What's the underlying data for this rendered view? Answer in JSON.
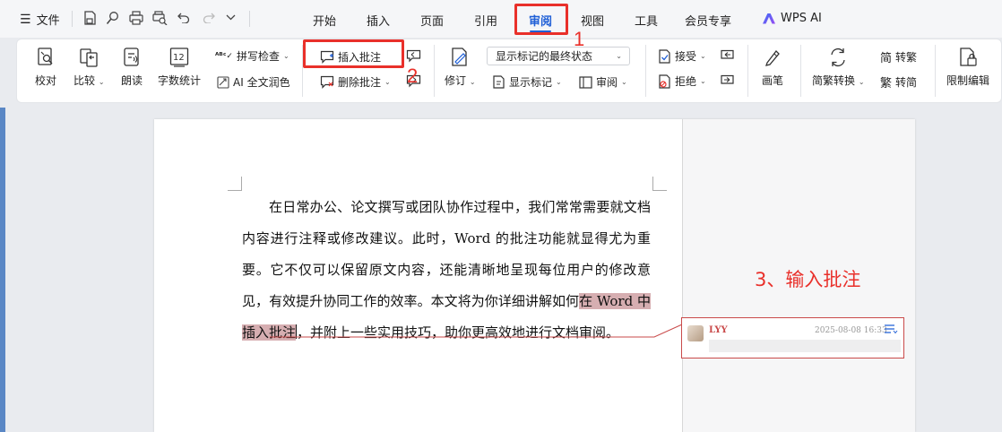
{
  "menu": {
    "file_label": "文件",
    "tabs": [
      {
        "label": "开始"
      },
      {
        "label": "插入"
      },
      {
        "label": "页面"
      },
      {
        "label": "引用"
      },
      {
        "label": "审阅",
        "active": true
      },
      {
        "label": "视图"
      },
      {
        "label": "工具"
      },
      {
        "label": "会员专享"
      }
    ],
    "wps_ai_label": "WPS AI",
    "quick_access_icons": [
      "save-icon",
      "find-icon",
      "print-icon",
      "print-preview-icon",
      "undo-icon",
      "redo-icon",
      "chevron-down-icon"
    ]
  },
  "ribbon": {
    "proofread": "校对",
    "compare": "比较",
    "read_aloud": "朗读",
    "word_count": "字数统计",
    "spell_check": "拼写检查",
    "ai_polish": "AI 全文润色",
    "insert_comment": "插入批注",
    "delete_comment": "删除批注",
    "track_changes": "修订",
    "markup_mode": "显示标记的最终状态",
    "show_markup": "显示标记",
    "review": "审阅",
    "accept": "接受",
    "reject": "拒绝",
    "pen": "画笔",
    "sc_convert": "简繁转换",
    "to_traditional": "转繁",
    "to_simplified": "转简",
    "restrict_editing": "限制编辑"
  },
  "annotations": {
    "step1": "1",
    "step2": "2",
    "step3": "3、输入批注",
    "color": "#e9302a"
  },
  "document": {
    "text_before": "在日常办公、论文撰写或团队协作过程中，我们常常需要就文档内容进行注释或修改建议。此时，Word 的批注功能就显得尤为重要。它不仅可以保留原文内容，还能清晰地呈现每位用户的修改意见，有效提升协同工作的效率。本文将为你详细讲解如何",
    "highlighted": "在 Word 中插入批注",
    "text_after": "，并附上一些实用技巧，助你更高效地进行文档审阅。"
  },
  "comment": {
    "author": "LYY",
    "time": "2025-08-08 16:33",
    "text": ""
  },
  "colors": {
    "accent": "#1f5fd6",
    "highlight": "#d6aeb1",
    "comment_border": "#c94a4a"
  }
}
